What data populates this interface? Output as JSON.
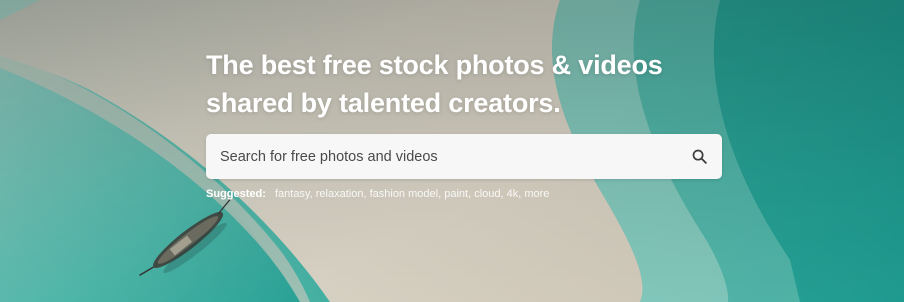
{
  "hero": {
    "title_line1": "The best free stock photos & videos",
    "title_line2": "shared by talented creators."
  },
  "search": {
    "placeholder": "Search for free photos and videos",
    "icon": "search-icon"
  },
  "suggested": {
    "label": "Suggested:",
    "items": [
      {
        "label": "fantasy"
      },
      {
        "label": "relaxation"
      },
      {
        "label": "fashion model"
      },
      {
        "label": "paint"
      },
      {
        "label": "cloud"
      },
      {
        "label": "4k"
      },
      {
        "label": "more"
      }
    ]
  },
  "colors": {
    "sea": "#2ea89e",
    "sand": "#d9d3c6",
    "search_bg": "#f7f7f7",
    "text_white": "#ffffff"
  }
}
